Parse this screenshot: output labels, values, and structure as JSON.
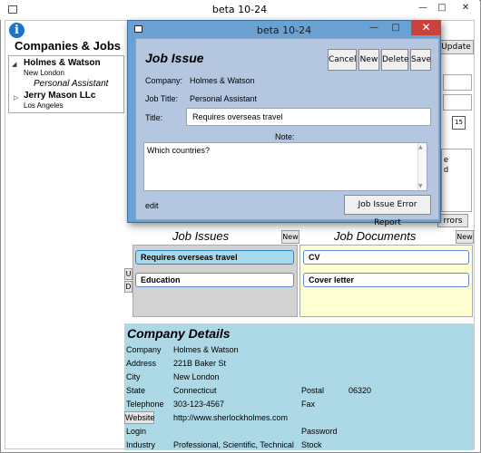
{
  "window": {
    "title": "beta 10-24"
  },
  "sidebar": {
    "heading": "Companies & Jobs",
    "companies": [
      {
        "name": "Holmes & Watson",
        "city": "New London",
        "jobs": [
          "Personal Assistant"
        ],
        "expanded": true
      },
      {
        "name": "Jerry Mason LLc",
        "city": "Los Angeles",
        "jobs": [],
        "expanded": false
      }
    ]
  },
  "right_panel": {
    "update_button": "/Update",
    "partial_text": [
      "e",
      "d"
    ],
    "errors_button": "rrors",
    "calendar_day": "15"
  },
  "job_issues": {
    "heading": "Job Issues",
    "new_button": "New",
    "items": [
      "Requires overseas travel",
      "Education"
    ],
    "selected_index": 0,
    "move_up": "U",
    "move_down": "D"
  },
  "job_documents": {
    "heading": "Job Documents",
    "new_button": "New",
    "items": [
      "CV",
      "Cover letter"
    ]
  },
  "company_details": {
    "title": "Company Details",
    "company_label": "Company",
    "company": "Holmes & Watson",
    "address_label": "Address",
    "address": "221B Baker St",
    "city_label": "City",
    "city": "New London",
    "state_label": "State",
    "state": "Connecticut",
    "postal_label": "Postal",
    "postal": "06320",
    "telephone_label": "Telephone",
    "telephone": "303-123-4567",
    "fax_label": "Fax",
    "website_button": "Website",
    "website": "http://www.sherlockholmes.com",
    "login_label": "Login",
    "password_label": "Password",
    "industry_label": "Industry",
    "industry": "Professional, Scientific, Technical",
    "stock_label": "Stock"
  },
  "dialog": {
    "title": "beta 10-24",
    "heading": "Job Issue",
    "buttons": {
      "cancel": "Cancel",
      "new": "New",
      "delete": "Delete",
      "save": "Save"
    },
    "company_label": "Company:",
    "company": "Holmes & Watson",
    "job_title_label": "Job Title:",
    "job_title": "Personal Assistant",
    "title_label": "Title:",
    "title_value": "Requires overseas travel",
    "note_label": "Note:",
    "note": "Which countries?",
    "mode": "edit",
    "error_report_button": "Job Issue Error Report"
  }
}
